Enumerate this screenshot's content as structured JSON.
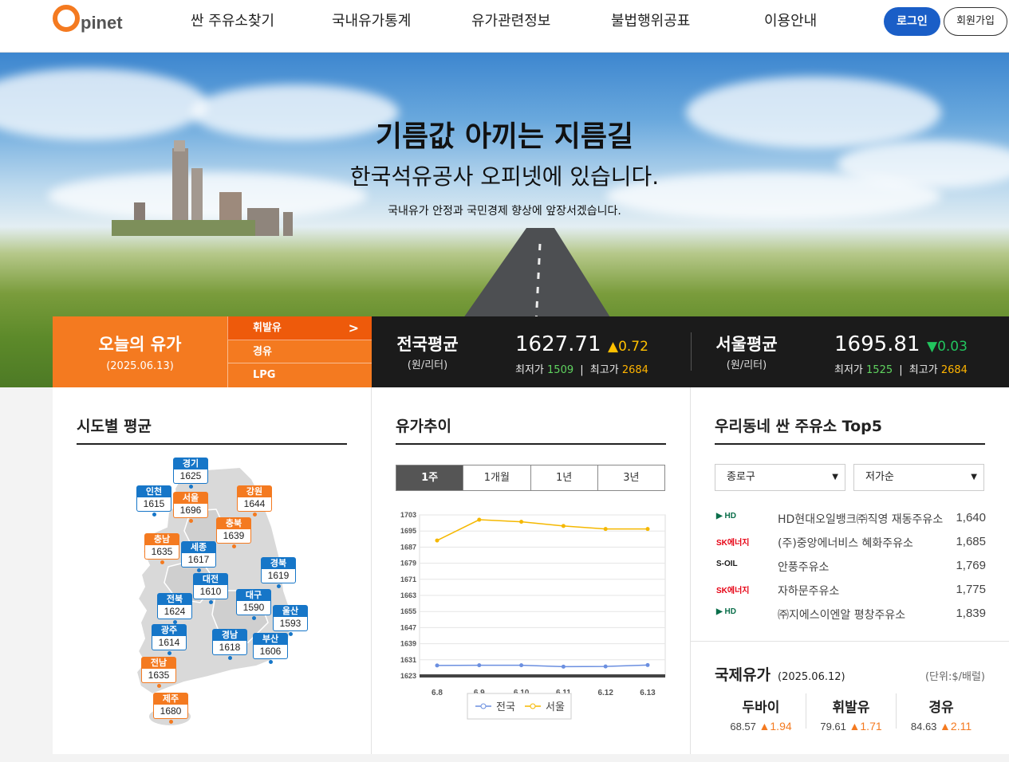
{
  "header": {
    "logo_text": "pinet",
    "nav": [
      "싼 주유소찾기",
      "국내유가통계",
      "유가관련정보",
      "불법행위공표",
      "이용안내"
    ],
    "login_label": "로그인",
    "join_label": "회원가입"
  },
  "hero": {
    "title": "기름값 아끼는 지름길",
    "subtitle": "한국석유공사 오피넷에 있습니다.",
    "description": "국내유가 안정과 국민경제 향상에 앞장서겠습니다."
  },
  "today": {
    "title": "오늘의 유가",
    "date": "(2025.06.13)",
    "fuel_tabs": [
      "휘발유",
      "경유",
      "LPG"
    ],
    "active_tab": "휘발유"
  },
  "national_avg": {
    "label": "전국평균",
    "unit": "(원/리터)",
    "value": "1627.71",
    "diff_symbol": "▲",
    "diff": "0.72",
    "min_label": "최저가",
    "min": "1509",
    "max_label": "최고가",
    "max": "2684"
  },
  "seoul_avg": {
    "label": "서울평균",
    "unit": "(원/리터)",
    "value": "1695.81",
    "diff_symbol": "▼",
    "diff": "0.03",
    "min_label": "최저가",
    "min": "1525",
    "max_label": "최고가",
    "max": "2684"
  },
  "region_panel": {
    "title": "시도별 평균",
    "regions": [
      {
        "name": "경기",
        "value": "1625",
        "color": "blue"
      },
      {
        "name": "인천",
        "value": "1615",
        "color": "blue"
      },
      {
        "name": "서울",
        "value": "1696",
        "color": "orange"
      },
      {
        "name": "강원",
        "value": "1644",
        "color": "orange"
      },
      {
        "name": "충북",
        "value": "1639",
        "color": "orange"
      },
      {
        "name": "충남",
        "value": "1635",
        "color": "orange"
      },
      {
        "name": "세종",
        "value": "1617",
        "color": "blue"
      },
      {
        "name": "대전",
        "value": "1610",
        "color": "blue"
      },
      {
        "name": "경북",
        "value": "1619",
        "color": "blue"
      },
      {
        "name": "전북",
        "value": "1624",
        "color": "blue"
      },
      {
        "name": "대구",
        "value": "1590",
        "color": "blue"
      },
      {
        "name": "울산",
        "value": "1593",
        "color": "blue"
      },
      {
        "name": "광주",
        "value": "1614",
        "color": "blue"
      },
      {
        "name": "경남",
        "value": "1618",
        "color": "blue"
      },
      {
        "name": "부산",
        "value": "1606",
        "color": "blue"
      },
      {
        "name": "전남",
        "value": "1635",
        "color": "orange"
      },
      {
        "name": "제주",
        "value": "1680",
        "color": "orange"
      }
    ]
  },
  "trend_panel": {
    "title": "유가추이",
    "period_tabs": [
      "1주",
      "1개월",
      "1년",
      "3년"
    ],
    "active_period": "1주"
  },
  "chart_data": {
    "type": "line",
    "x": [
      "6.8",
      "6.9",
      "6.10",
      "6.11",
      "6.12",
      "6.13"
    ],
    "yticks": [
      1623,
      1631,
      1639,
      1647,
      1655,
      1663,
      1671,
      1679,
      1687,
      1695,
      1703
    ],
    "ylim": [
      1623,
      1703
    ],
    "series": [
      {
        "name": "전국",
        "color": "#6b8fe0",
        "values": [
          1628.2,
          1628.3,
          1628.3,
          1627.6,
          1627.7,
          1628.4
        ]
      },
      {
        "name": "서울",
        "color": "#f5b800",
        "values": [
          1690.3,
          1700.6,
          1699.6,
          1697.5,
          1696.0,
          1696.0
        ]
      }
    ],
    "legend_position": "bottom",
    "grid": true
  },
  "top5_panel": {
    "title": "우리동네 싼 주유소 Top5",
    "district": "종로구",
    "sort": "저가순",
    "stations": [
      {
        "brand": "HD",
        "brand_color": "#0a6e4a",
        "name": "HD현대오일뱅크㈜직영 재동주유소",
        "price": "1,640"
      },
      {
        "brand": "SK에너지",
        "brand_color": "#e60012",
        "name": "(주)중앙에너비스 혜화주유소",
        "price": "1,685"
      },
      {
        "brand": "S-OIL",
        "brand_color": "#1a1a1a",
        "name": "안풍주유소",
        "price": "1,769"
      },
      {
        "brand": "SK에너지",
        "brand_color": "#e60012",
        "name": "자하문주유소",
        "price": "1,775"
      },
      {
        "brand": "HD",
        "brand_color": "#0a6e4a",
        "name": "㈜지에스이엔알 평창주유소",
        "price": "1,839"
      }
    ]
  },
  "intl_panel": {
    "title": "국제유가",
    "date": "(2025.06.12)",
    "unit": "(단위:$/배럴)",
    "items": [
      {
        "name": "두바이",
        "value": "68.57",
        "diff": "▲1.94"
      },
      {
        "name": "휘발유",
        "value": "79.61",
        "diff": "▲1.71"
      },
      {
        "name": "경유",
        "value": "84.63",
        "diff": "▲2.11"
      }
    ]
  }
}
